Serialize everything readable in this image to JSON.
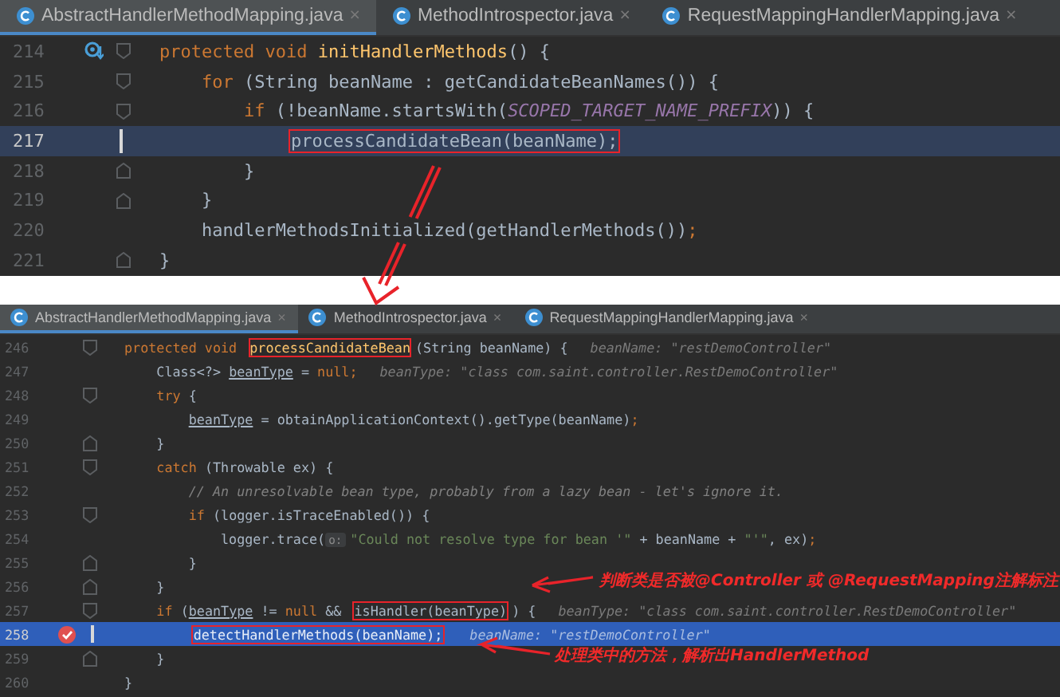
{
  "panels": [
    {
      "tabs": [
        {
          "label": "AbstractHandlerMethodMapping.java",
          "close": "×",
          "selected": true
        },
        {
          "label": "MethodIntrospector.java",
          "close": "×",
          "selected": false
        },
        {
          "label": "RequestMappingHandlerMapping.java",
          "close": "×",
          "selected": false
        }
      ],
      "lines": [
        {
          "number": "214",
          "override_marker": true,
          "breakpoint": false,
          "fold_start": true,
          "fold_end": false,
          "current": false,
          "execution": false,
          "tokens": [
            {
              "text": "protected void ",
              "kind": "kw"
            },
            {
              "text": "initHandlerMethods",
              "kind": "decl"
            },
            {
              "text": "() {",
              "kind": "plain"
            }
          ]
        },
        {
          "number": "215",
          "override_marker": false,
          "breakpoint": false,
          "fold_start": true,
          "fold_end": false,
          "current": false,
          "execution": false,
          "tokens": [
            {
              "text": "    for ",
              "kind": "kw"
            },
            {
              "text": "(String beanName : getCandidateBeanNames()) {",
              "kind": "plain"
            }
          ]
        },
        {
          "number": "216",
          "override_marker": false,
          "breakpoint": false,
          "fold_start": true,
          "fold_end": false,
          "current": false,
          "execution": false,
          "tokens": [
            {
              "text": "        if ",
              "kind": "kw"
            },
            {
              "text": "(!beanName.startsWith(",
              "kind": "plain"
            },
            {
              "text": "SCOPED_TARGET_NAME_PREFIX",
              "kind": "const"
            },
            {
              "text": ")) {",
              "kind": "plain"
            }
          ]
        },
        {
          "number": "217",
          "override_marker": false,
          "breakpoint": false,
          "fold_start": false,
          "fold_end": false,
          "current": true,
          "execution": false,
          "tokens": [
            {
              "text": "            processCandidateBean(beanName);",
              "kind": "plain",
              "boxed": true
            }
          ]
        },
        {
          "number": "218",
          "override_marker": false,
          "breakpoint": false,
          "fold_start": false,
          "fold_end": true,
          "current": false,
          "execution": false,
          "tokens": [
            {
              "text": "        }",
              "kind": "plain"
            }
          ]
        },
        {
          "number": "219",
          "override_marker": false,
          "breakpoint": false,
          "fold_start": false,
          "fold_end": true,
          "current": false,
          "execution": false,
          "tokens": [
            {
              "text": "    }",
              "kind": "plain"
            }
          ]
        },
        {
          "number": "220",
          "override_marker": false,
          "breakpoint": false,
          "fold_start": false,
          "fold_end": false,
          "current": false,
          "execution": false,
          "tokens": [
            {
              "text": "    handlerMethodsInitialized(getHandlerMethods())",
              "kind": "plain"
            },
            {
              "text": ";",
              "kind": "kw"
            }
          ]
        },
        {
          "number": "221",
          "override_marker": false,
          "breakpoint": false,
          "fold_start": false,
          "fold_end": true,
          "current": false,
          "execution": false,
          "tokens": [
            {
              "text": "}",
              "kind": "plain"
            }
          ]
        }
      ]
    },
    {
      "tabs": [
        {
          "label": "AbstractHandlerMethodMapping.java",
          "close": "×",
          "selected": true
        },
        {
          "label": "MethodIntrospector.java",
          "close": "×",
          "selected": false
        },
        {
          "label": "RequestMappingHandlerMapping.java",
          "close": "×",
          "selected": false
        }
      ],
      "lines": [
        {
          "number": "246",
          "override_marker": false,
          "breakpoint": false,
          "fold_start": true,
          "fold_end": false,
          "current": false,
          "execution": false,
          "tokens": [
            {
              "text": "protected void ",
              "kind": "kw"
            },
            {
              "text": "processCandidateBean",
              "kind": "decl",
              "boxed": true
            },
            {
              "text": "(String beanName) {",
              "kind": "plain"
            }
          ],
          "hint": "beanName: \"restDemoController\""
        },
        {
          "number": "247",
          "override_marker": false,
          "breakpoint": false,
          "fold_start": false,
          "fold_end": false,
          "current": false,
          "execution": false,
          "tokens": [
            {
              "text": "    Class<?> ",
              "kind": "plain"
            },
            {
              "text": "beanType",
              "kind": "under"
            },
            {
              "text": " = ",
              "kind": "plain"
            },
            {
              "text": "null;",
              "kind": "kw"
            }
          ],
          "hint": "beanType: \"class com.saint.controller.RestDemoController\""
        },
        {
          "number": "248",
          "override_marker": false,
          "breakpoint": false,
          "fold_start": true,
          "fold_end": false,
          "current": false,
          "execution": false,
          "tokens": [
            {
              "text": "    try ",
              "kind": "kw"
            },
            {
              "text": "{",
              "kind": "plain"
            }
          ]
        },
        {
          "number": "249",
          "override_marker": false,
          "breakpoint": false,
          "fold_start": false,
          "fold_end": false,
          "current": false,
          "execution": false,
          "tokens": [
            {
              "text": "        beanType",
              "kind": "under"
            },
            {
              "text": " = obtainApplicationContext().getType(beanName)",
              "kind": "plain"
            },
            {
              "text": ";",
              "kind": "kw"
            }
          ]
        },
        {
          "number": "250",
          "override_marker": false,
          "breakpoint": false,
          "fold_start": false,
          "fold_end": true,
          "current": false,
          "execution": false,
          "tokens": [
            {
              "text": "    }",
              "kind": "plain"
            }
          ]
        },
        {
          "number": "251",
          "override_marker": false,
          "breakpoint": false,
          "fold_start": true,
          "fold_end": false,
          "current": false,
          "execution": false,
          "tokens": [
            {
              "text": "    catch ",
              "kind": "kw"
            },
            {
              "text": "(Throwable ex) {",
              "kind": "plain"
            }
          ]
        },
        {
          "number": "252",
          "override_marker": false,
          "breakpoint": false,
          "fold_start": false,
          "fold_end": false,
          "current": false,
          "execution": false,
          "tokens": [
            {
              "text": "        // An unresolvable bean type, probably from a lazy bean - let's ignore it.",
              "kind": "cmt"
            }
          ]
        },
        {
          "number": "253",
          "override_marker": false,
          "breakpoint": false,
          "fold_start": true,
          "fold_end": false,
          "current": false,
          "execution": false,
          "tokens": [
            {
              "text": "        if ",
              "kind": "kw"
            },
            {
              "text": "(logger.isTraceEnabled()) {",
              "kind": "plain"
            }
          ]
        },
        {
          "number": "254",
          "override_marker": false,
          "breakpoint": false,
          "fold_start": false,
          "fold_end": false,
          "current": false,
          "execution": false,
          "tokens": [
            {
              "text": "            logger.trace(",
              "kind": "plain"
            },
            {
              "text": "o:",
              "kind": "param"
            },
            {
              "text": "\"Could not resolve type for bean '\"",
              "kind": "str"
            },
            {
              "text": " + beanName + ",
              "kind": "plain"
            },
            {
              "text": "\"'\"",
              "kind": "str"
            },
            {
              "text": ", ex)",
              "kind": "plain"
            },
            {
              "text": ";",
              "kind": "kw"
            }
          ]
        },
        {
          "number": "255",
          "override_marker": false,
          "breakpoint": false,
          "fold_start": false,
          "fold_end": true,
          "current": false,
          "execution": false,
          "tokens": [
            {
              "text": "        }",
              "kind": "plain"
            }
          ]
        },
        {
          "number": "256",
          "override_marker": false,
          "breakpoint": false,
          "fold_start": false,
          "fold_end": true,
          "current": false,
          "execution": false,
          "tokens": [
            {
              "text": "    }",
              "kind": "plain"
            }
          ]
        },
        {
          "number": "257",
          "override_marker": false,
          "breakpoint": false,
          "fold_start": true,
          "fold_end": false,
          "current": false,
          "execution": false,
          "tokens": [
            {
              "text": "    if ",
              "kind": "kw"
            },
            {
              "text": "(",
              "kind": "plain"
            },
            {
              "text": "beanType",
              "kind": "under"
            },
            {
              "text": " != ",
              "kind": "plain"
            },
            {
              "text": "null ",
              "kind": "kw"
            },
            {
              "text": "&& ",
              "kind": "plain"
            },
            {
              "text": "isHandler(beanType)",
              "kind": "plain",
              "boxed": true
            },
            {
              "text": ") {",
              "kind": "plain"
            }
          ],
          "hint": "beanType: \"class com.saint.controller.RestDemoController\""
        },
        {
          "number": "258",
          "override_marker": false,
          "breakpoint": true,
          "fold_start": false,
          "fold_end": false,
          "current": false,
          "execution": true,
          "tokens": [
            {
              "text": "        detectHandlerMethods(beanName);",
              "kind": "plain",
              "boxed": true
            }
          ],
          "hint": "beanName: \"restDemoController\""
        },
        {
          "number": "259",
          "override_marker": false,
          "breakpoint": false,
          "fold_start": false,
          "fold_end": true,
          "current": false,
          "execution": false,
          "tokens": [
            {
              "text": "    }",
              "kind": "plain"
            }
          ]
        },
        {
          "number": "260",
          "override_marker": false,
          "breakpoint": false,
          "fold_start": false,
          "fold_end": false,
          "current": false,
          "execution": false,
          "tokens": [
            {
              "text": "}",
              "kind": "plain"
            }
          ]
        }
      ]
    }
  ],
  "annotations": [
    {
      "text": "判断类是否被@Controller 或 @RequestMapping注解标注"
    },
    {
      "text": "处理类中的方法，解析出HandlerMethod"
    }
  ]
}
